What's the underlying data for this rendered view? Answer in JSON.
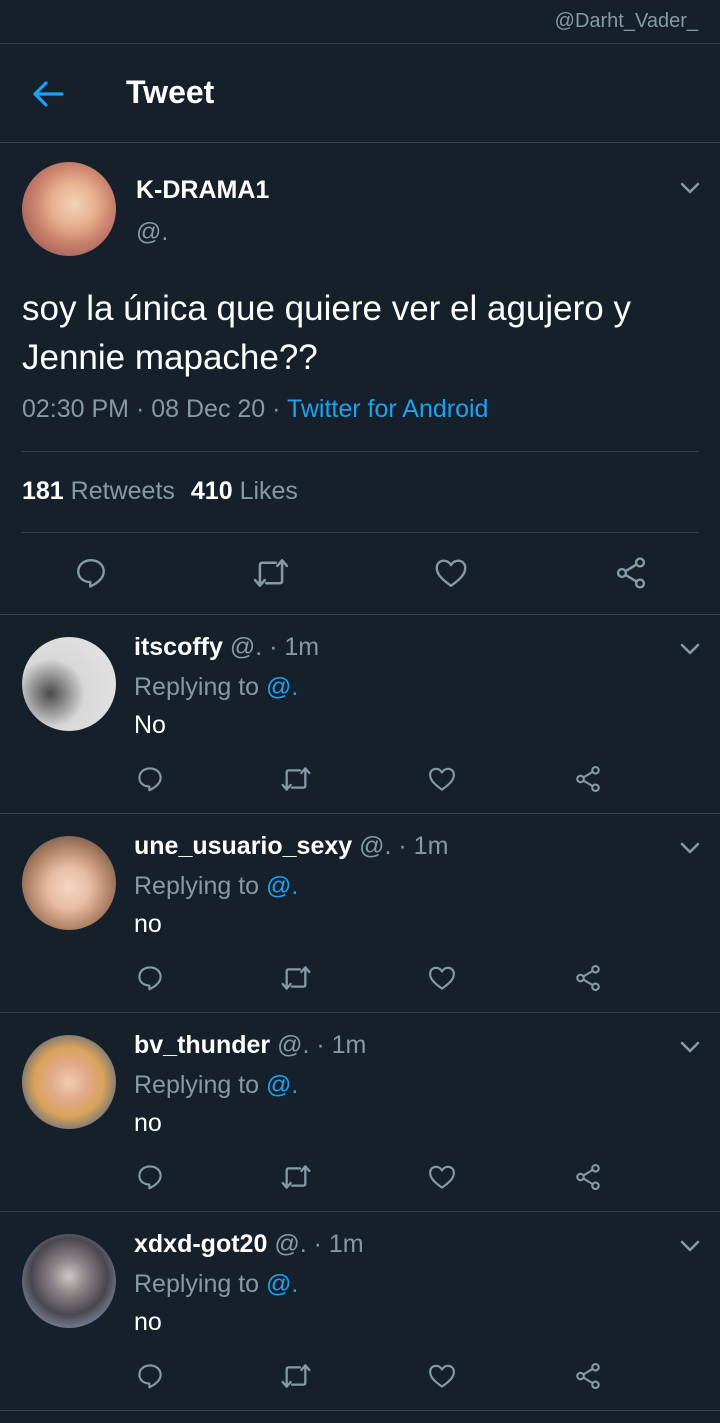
{
  "watermark": "@Darht_Vader_",
  "header": {
    "title": "Tweet",
    "back_icon": "arrow-left-icon",
    "accent": "#1da1f2"
  },
  "tweet": {
    "name": "K-DRAMA1",
    "handle": "@.",
    "text": "soy la única que quiere ver el agujero y Jennie mapache??",
    "time": "02:30 PM",
    "sep": " · ",
    "date": "08 Dec 20",
    "sep2": " · ",
    "source": "Twitter for Android",
    "retweets_count": "181",
    "retweets_label": "Retweets",
    "likes_count": "410",
    "likes_label": "Likes",
    "actions": [
      "reply-icon",
      "retweet-icon",
      "like-icon",
      "share-icon"
    ]
  },
  "replies": [
    {
      "name": "itscoffy",
      "handle": "@. · 1m",
      "replying_prefix": "Replying to ",
      "replying_to": "@.",
      "text": "No"
    },
    {
      "name": "une_usuario_sexy",
      "handle": "@. · 1m",
      "replying_prefix": "Replying to ",
      "replying_to": "@.",
      "text": "no"
    },
    {
      "name": "bv_thunder",
      "handle": "@. · 1m",
      "replying_prefix": "Replying to ",
      "replying_to": "@.",
      "text": "no"
    },
    {
      "name": "xdxd-got20",
      "handle": "@. · 1m",
      "replying_prefix": "Replying to ",
      "replying_to": "@.",
      "text": "no"
    }
  ],
  "colors": {
    "background": "#15202b",
    "muted": "#8899a6",
    "border": "#38444d",
    "link": "#1da1f2"
  }
}
